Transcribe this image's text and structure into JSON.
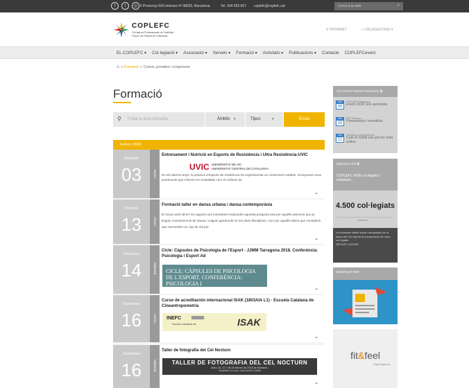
{
  "topbar": {
    "address": "Il Provença 500 entresol 4ª 08025, Barcelona",
    "phone": "Tel. 934 555 607",
    "email": "coplefc@coplefc.cat",
    "search_placeholder": "Cerca a la web"
  },
  "header": {
    "brand": "COPLEFC",
    "brand_sub1": "Col·legi de Professionals de l'Activitat",
    "brand_sub2": "Física i de l'Esport de Catalunya",
    "intranet": "INTRANET",
    "delegacions": "DELEGACIONS"
  },
  "nav": {
    "items": [
      "EL COPLEFC",
      "Col·legiació",
      "Associació",
      "Serveis",
      "Formació",
      "Activitats",
      "Publicacions",
      "Contacte",
      "COPLEFCevent"
    ]
  },
  "breadcrumb": {
    "link": "Formació",
    "current": "Cursos, jornades i congressos"
  },
  "page": {
    "title": "Formació"
  },
  "filters": {
    "search_placeholder": "Troba la teva consulta",
    "ambits": "Àmbits",
    "tipus": "Tipus",
    "send": "Envia"
  },
  "month": "Febrer 2018",
  "events": [
    {
      "day_name": "Dissabte",
      "day": "03",
      "category": "cursos",
      "title": "Entrenament i Nutrició en Esports de Resistència i Ultra Resistència-UVIC",
      "text": "En els darrers anys, la pràctica d'esports de resistència ha experimentat un creixement notable, incorporant nous practicants que s'inicien en modalitats com el ciclisme de",
      "logo_mark": "UVIC",
      "logo_line1": "UNIVERSITAT DE VIC",
      "logo_line2": "UNIVERSITAT CENTRAL DE CATALUNYA"
    },
    {
      "day_name": "Dimarts",
      "day": "13",
      "category": "cursos",
      "title": "Formació taller en dansa urbana i dansa contemporània",
      "text": "Et mous amb ritme? En aquest curs intentarem respondre aquesta pregunta tant per aquells alumnes que ja tinguin coneixements de dansa i vulguin aprofundir en les dues disciplines, com per aquells altres que considerin que necessiten un cop de mà per"
    },
    {
      "day_name": "Dimecres",
      "day": "14",
      "category": "jornades",
      "title": "Cicle: Càpsules de Psicologia de l'Esport - JJMM Tarragona 2018. Conferència: Psicologia i Esport Ad",
      "banner": "CICLE: CÀPSULES DE PSICOLOGIA DE L'ESPORT. CONFERÈNCIA: PSICOLOGIA I"
    },
    {
      "day_name": "Divendres",
      "day": "16",
      "category": "cursos",
      "title": "Curso de acreditación internacional ISAK (1803AIA L1) - Escuela Catalana de Cineantropometría",
      "inefc": "INEFC",
      "inefc_sub": "Escola Catalana de",
      "isak": "ISAK"
    },
    {
      "day_name": "Divendres",
      "day": "16",
      "category": "jornades",
      "title": "Taller de fotografia del Cel Nocturn",
      "banner_title": "TALLER DE FOTOGRAFIA DEL CEL NOCTURN",
      "banner_date": "Dies 16, 17 i 18 de febrer de 2018 al Montsec.",
      "banner_info": "Impartido el curso: Joan Antoni Català"
    }
  ],
  "sidebar": {
    "activitat_header": "ACTIVITAT INSTITUCIONAL",
    "activitat_items": [
      {
        "month": "MAR",
        "day": "06",
        "small": "COPLEFC Tarragona",
        "text": "Event 2018. Els associats"
      },
      {
        "month": "FEB",
        "day": "28",
        "small": "FEP Vilanova",
        "text": "Presentació i veredicte"
      },
      {
        "month": "FEB",
        "day": "22",
        "small": "Trobada social Barcelona",
        "text": "Com el mòbil ens pot fer més actius"
      }
    ],
    "destacats_header": "DESTACATS",
    "destacats_text": "COPLEFC 4500 col·legiats i comptant...",
    "destacats_big": "4.500 col·legiats",
    "destacats_logo": "COPLEFC",
    "destacats_desc": "Un indicador fiable sobre l'acceptació de la tasca del Col·legi és la incorporació de nous col·legiats",
    "destacats_more": "SEGUIR LLEGINT",
    "newsletter_header": "NEWSLETTER",
    "ad_main": "fit",
    "ad_amp": "&",
    "ad_end": "feel",
    "ad_sub": "Digital Agency"
  }
}
